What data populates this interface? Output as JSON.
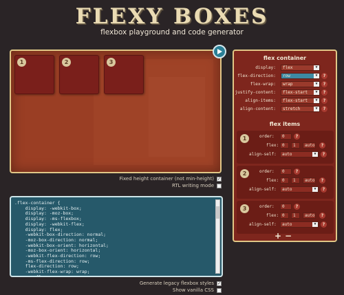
{
  "header": {
    "logo": "FLEXY BOXES",
    "tagline": "flexbox playground and code generator"
  },
  "preview": {
    "items": [
      "1",
      "2",
      "3"
    ]
  },
  "options": {
    "fixed_height": {
      "label": "Fixed height container (not min-height)",
      "checked": true
    },
    "rtl": {
      "label": "RTL writing mode",
      "checked": false
    },
    "legacy": {
      "label": "Generate legacy flexbox styles",
      "checked": true
    },
    "vanilla": {
      "label": "Show vanilla CSS",
      "checked": false
    }
  },
  "code": ".flex-container {\n    display: -webkit-box;\n    display: -moz-box;\n    display: -ms-flexbox;\n    display: -webkit-flex;\n    display: flex;\n    -webkit-box-direction: normal;\n    -moz-box-direction: normal;\n    -webkit-box-orient: horizontal;\n    -moz-box-orient: horizontal;\n    -webkit-flex-direction: row;\n    -ms-flex-direction: row;\n    flex-direction: row;\n    -webkit-flex-wrap: wrap;\n    -ms-flex-wrap: wrap;",
  "container": {
    "title": "flex container",
    "rows": [
      {
        "label": "display:",
        "value": "flex"
      },
      {
        "label": "flex-direction:",
        "value": "row"
      },
      {
        "label": "flex-wrap:",
        "value": "wrap"
      },
      {
        "label": "justify-content:",
        "value": "flex-start"
      },
      {
        "label": "align-items:",
        "value": "flex-start"
      },
      {
        "label": "align-content:",
        "value": "stretch"
      }
    ]
  },
  "items": {
    "title": "flex items",
    "order_label": "order:",
    "flex_label": "flex:",
    "align_self_label": "align-self:",
    "help": "?",
    "list": [
      {
        "num": "1",
        "order": "0",
        "grow": "0",
        "shrink": "1",
        "basis": "auto",
        "align_self": "auto"
      },
      {
        "num": "2",
        "order": "0",
        "grow": "0",
        "shrink": "1",
        "basis": "auto",
        "align_self": "auto"
      },
      {
        "num": "3",
        "order": "0",
        "grow": "0",
        "shrink": "1",
        "basis": "auto",
        "align_self": "auto"
      }
    ],
    "add": "+",
    "remove": "−"
  }
}
